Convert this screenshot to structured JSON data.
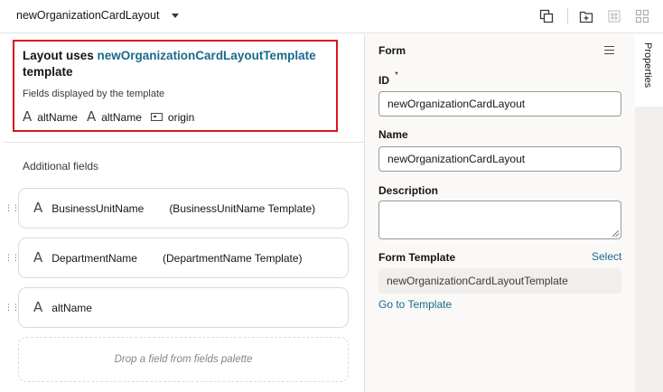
{
  "header": {
    "layout_name": "newOrganizationCardLayout",
    "icons": [
      "duplicate-icon",
      "add-layout-icon",
      "grid-disabled-icon",
      "grid-layout-icon"
    ]
  },
  "template_info": {
    "title_prefix": "Layout uses",
    "template_link": "newOrganizationCardLayoutTemplate",
    "title_suffix": "template",
    "subtitle": "Fields displayed by the template",
    "fields": [
      {
        "label": "altName",
        "icon": "text-field-icon"
      },
      {
        "label": "altName",
        "icon": "text-field-icon"
      },
      {
        "label": "origin",
        "icon": "object-field-icon"
      }
    ]
  },
  "additional_fields": {
    "heading": "Additional fields",
    "rows": [
      {
        "name": "BusinessUnitName",
        "template": "(BusinessUnitName Template)"
      },
      {
        "name": "DepartmentName",
        "template": "(DepartmentName Template)"
      },
      {
        "name": "altName",
        "template": ""
      }
    ],
    "drop_hint": "Drop a field from fields palette"
  },
  "properties": {
    "section_title": "Form",
    "id_label": "ID",
    "id_required_mark": "*",
    "id_value": "newOrganizationCardLayout",
    "name_label": "Name",
    "name_value": "newOrganizationCardLayout",
    "description_label": "Description",
    "description_value": "",
    "form_template_label": "Form Template",
    "select_link": "Select",
    "form_template_value": "newOrganizationCardLayoutTemplate",
    "goto_link": "Go to Template"
  },
  "side_tab": {
    "label": "Properties"
  },
  "colors": {
    "highlight_border": "#d9161d",
    "link": "#1a6a8c"
  }
}
